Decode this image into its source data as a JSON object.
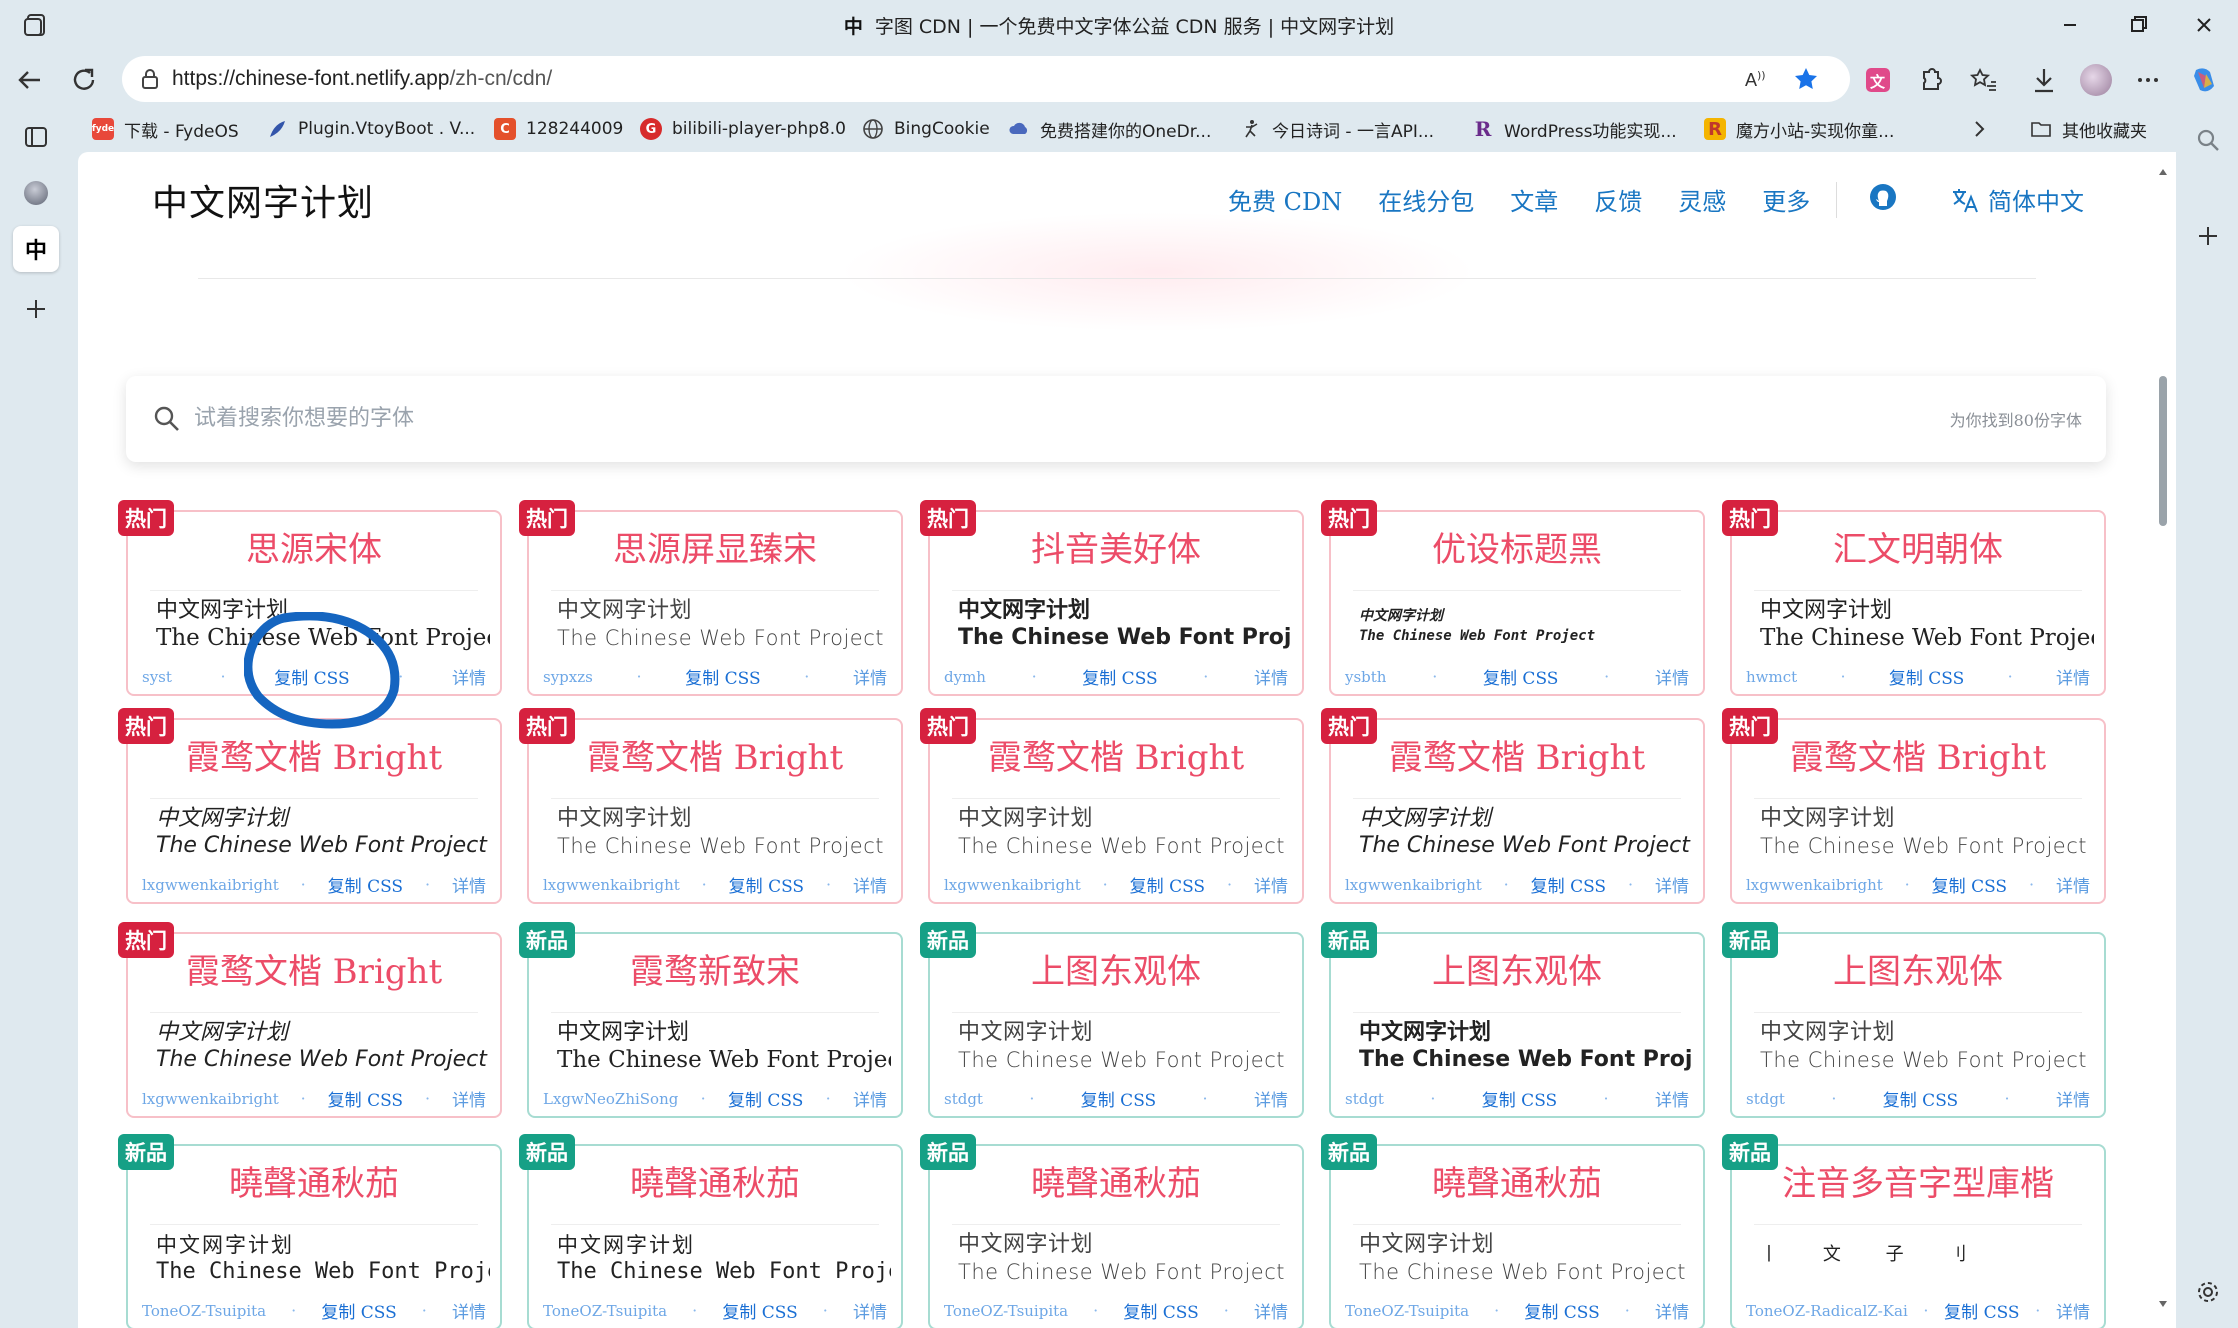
{
  "window": {
    "tab_glyph": "中",
    "title": "字图 CDN | 一个免费中文字体公益 CDN 服务 | 中文网字计划"
  },
  "address": {
    "url_host": "https://chinese-font.netlify.app",
    "url_path": "/zh-cn/cdn/"
  },
  "bookmarks": [
    {
      "label": "下载 - FydeOS",
      "icon": "fyde",
      "color": "#e8483a"
    },
    {
      "label": "Plugin.VtoyBoot . V...",
      "icon": "feather-icon",
      "color": "#3355aa"
    },
    {
      "label": "128244009",
      "icon": "C",
      "color": "#e4502b"
    },
    {
      "label": "bilibili-player-php8.0",
      "icon": "G",
      "color": "#d72b2b"
    },
    {
      "label": "BingCookie",
      "icon": "globe-icon",
      "color": "#444444"
    },
    {
      "label": "免费搭建你的OneDr...",
      "icon": "cloud-icon",
      "color": "#4a69bd"
    },
    {
      "label": "今日诗词 - 一言API...",
      "icon": "dancer-icon",
      "color": "#333333"
    },
    {
      "label": "WordPress功能实现...",
      "icon": "R",
      "color": "#6a2b8b"
    },
    {
      "label": "魔方小站-实现你童...",
      "icon": "R",
      "color": "#c0392b"
    }
  ],
  "other_bookmarks": "其他收藏夹",
  "sidebar_tab_glyph": "中",
  "site": {
    "logo": "中文网字计划",
    "nav": [
      "免费 CDN",
      "在线分包",
      "文章",
      "反馈",
      "灵感",
      "更多"
    ],
    "language": "简体中文"
  },
  "search": {
    "placeholder": "试着搜索你想要的字体",
    "result_count": "为你找到80份字体"
  },
  "card_labels": {
    "copy": "复制 CSS",
    "detail": "详情"
  },
  "cards": [
    {
      "badge": "热门",
      "type": "hot",
      "title": "思源宋体",
      "zh": "中文网字计划",
      "en": "The Chinese Web Font Project",
      "code": "syst",
      "style": "serif"
    },
    {
      "badge": "热门",
      "type": "hot",
      "title": "思源屏显臻宋",
      "zh": "中文网字计划",
      "en": "The Chinese Web Font Project",
      "code": "sypxzs",
      "style": "sans"
    },
    {
      "badge": "热门",
      "type": "hot",
      "title": "抖音美好体",
      "zh": "中文网字计划",
      "en": "The Chinese Web Font Project",
      "code": "dymh",
      "style": "bold"
    },
    {
      "badge": "热门",
      "type": "hot",
      "title": "优设标题黑",
      "zh": "中文网字计划",
      "en": "The Chinese Web Font Project",
      "code": "ysbth",
      "style": "tiny"
    },
    {
      "badge": "热门",
      "type": "hot",
      "title": "汇文明朝体",
      "zh": "中文网字计划",
      "en": "The Chinese Web Font Project",
      "code": "hwmct",
      "style": "serif"
    },
    {
      "badge": "热门",
      "type": "hot",
      "title": "霞鹜文楷 Bright",
      "zh": "中文网字计划",
      "en": "The Chinese Web Font Project",
      "code": "lxgwwenkaibright",
      "style": "italic"
    },
    {
      "badge": "热门",
      "type": "hot",
      "title": "霞鹜文楷 Bright",
      "zh": "中文网字计划",
      "en": "The Chinese Web Font Project",
      "code": "lxgwwenkaibright",
      "style": "sans"
    },
    {
      "badge": "热门",
      "type": "hot",
      "title": "霞鹜文楷 Bright",
      "zh": "中文网字计划",
      "en": "The Chinese Web Font Project",
      "code": "lxgwwenkaibright",
      "style": "sans"
    },
    {
      "badge": "热门",
      "type": "hot",
      "title": "霞鹜文楷 Bright",
      "zh": "中文网字计划",
      "en": "The Chinese Web Font Project",
      "code": "lxgwwenkaibright",
      "style": "italic"
    },
    {
      "badge": "热门",
      "type": "hot",
      "title": "霞鹜文楷 Bright",
      "zh": "中文网字计划",
      "en": "The Chinese Web Font Project",
      "code": "lxgwwenkaibright",
      "style": "sans"
    },
    {
      "badge": "热门",
      "type": "hot",
      "title": "霞鹜文楷 Bright",
      "zh": "中文网字计划",
      "en": "The Chinese Web Font Project",
      "code": "lxgwwenkaibright",
      "style": "italic"
    },
    {
      "badge": "新品",
      "type": "new",
      "title": "霞鹜新致宋",
      "zh": "中文网字计划",
      "en": "The Chinese Web Font Project",
      "code": "LxgwNeoZhiSong",
      "style": "serif"
    },
    {
      "badge": "新品",
      "type": "new",
      "title": "上图东观体",
      "zh": "中文网字计划",
      "en": "The Chinese Web Font Project",
      "code": "stdgt",
      "style": "light"
    },
    {
      "badge": "新品",
      "type": "new",
      "title": "上图东观体",
      "zh": "中文网字计划",
      "en": "The Chinese Web Font Project",
      "code": "stdgt",
      "style": "bold"
    },
    {
      "badge": "新品",
      "type": "new",
      "title": "上图东观体",
      "zh": "中文网字计划",
      "en": "The Chinese Web Font Project",
      "code": "stdgt",
      "style": "sans"
    },
    {
      "badge": "新品",
      "type": "new",
      "title": "曉聲通秋茄",
      "zh": "中文网字计划",
      "en": "The Chinese Web Font Project",
      "code": "ToneOZ-Tsuipita",
      "style": "zhuyin"
    },
    {
      "badge": "新品",
      "type": "new",
      "title": "曉聲通秋茄",
      "zh": "中文网字计划",
      "en": "The Chinese Web Font Project",
      "code": "ToneOZ-Tsuipita",
      "style": "zhuyin"
    },
    {
      "badge": "新品",
      "type": "new",
      "title": "曉聲通秋茄",
      "zh": "中文网字计划",
      "en": "The Chinese Web Font Project",
      "code": "ToneOZ-Tsuipita",
      "style": "sans"
    },
    {
      "badge": "新品",
      "type": "new",
      "title": "曉聲通秋茄",
      "zh": "中文网字计划",
      "en": "The Chinese Web Font Project",
      "code": "ToneOZ-Tsuipita",
      "style": "sans"
    },
    {
      "badge": "新品",
      "type": "new",
      "title": "注音多音字型庫楷",
      "zh": "丨 文 子 刂",
      "en": "",
      "code": "ToneOZ-RadicalZ-Kai",
      "style": "sparse"
    }
  ]
}
